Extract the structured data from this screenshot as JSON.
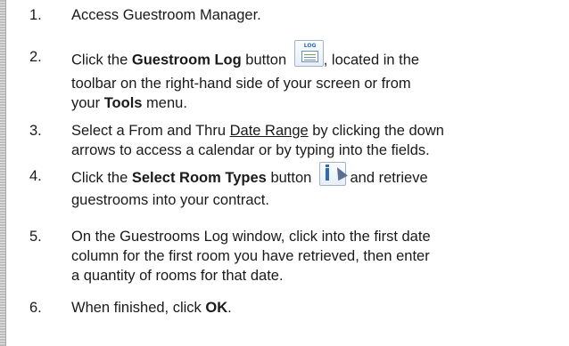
{
  "steps": [
    {
      "num": "1.",
      "lines": [
        {
          "t1": "Access Guestroom Manager."
        }
      ]
    },
    {
      "num": "2.",
      "l1_a": "Click the ",
      "l1_b": "Guestroom Log",
      "l1_c": " button ",
      "l1_d": ", located in the",
      "l2": "toolbar on the right-hand side of your screen or from",
      "l3_a": "your ",
      "l3_b": "Tools",
      "l3_c": " menu.",
      "icon": "guestroom-log-icon",
      "icon_tag": "LOG"
    },
    {
      "num": "3.",
      "l1_a": "Select a From and Thru ",
      "l1_b": "Date Range",
      "l1_c": " by clicking the down",
      "l2": "arrows to access a calendar or by typing into the fields."
    },
    {
      "num": "4.",
      "l1_a": "Click the ",
      "l1_b": "Select Room Types",
      "l1_c": " button ",
      "l1_d": " and retrieve",
      "l2": "guestrooms into your contract.",
      "icon": "select-room-types-icon"
    },
    {
      "num": "5.",
      "l1": "On the Guestrooms Log window, click into the first date",
      "l2": "column for the first room you have retrieved, then enter",
      "l3": "a quantity of rooms for that date."
    },
    {
      "num": "6.",
      "l1_a": "When finished, click ",
      "l1_b": "OK",
      "l1_c": "."
    }
  ],
  "colors": {
    "text": "#1a1a1a",
    "icon_blue": "#2e6ab1",
    "rule_gray": "#bdbdbd"
  }
}
